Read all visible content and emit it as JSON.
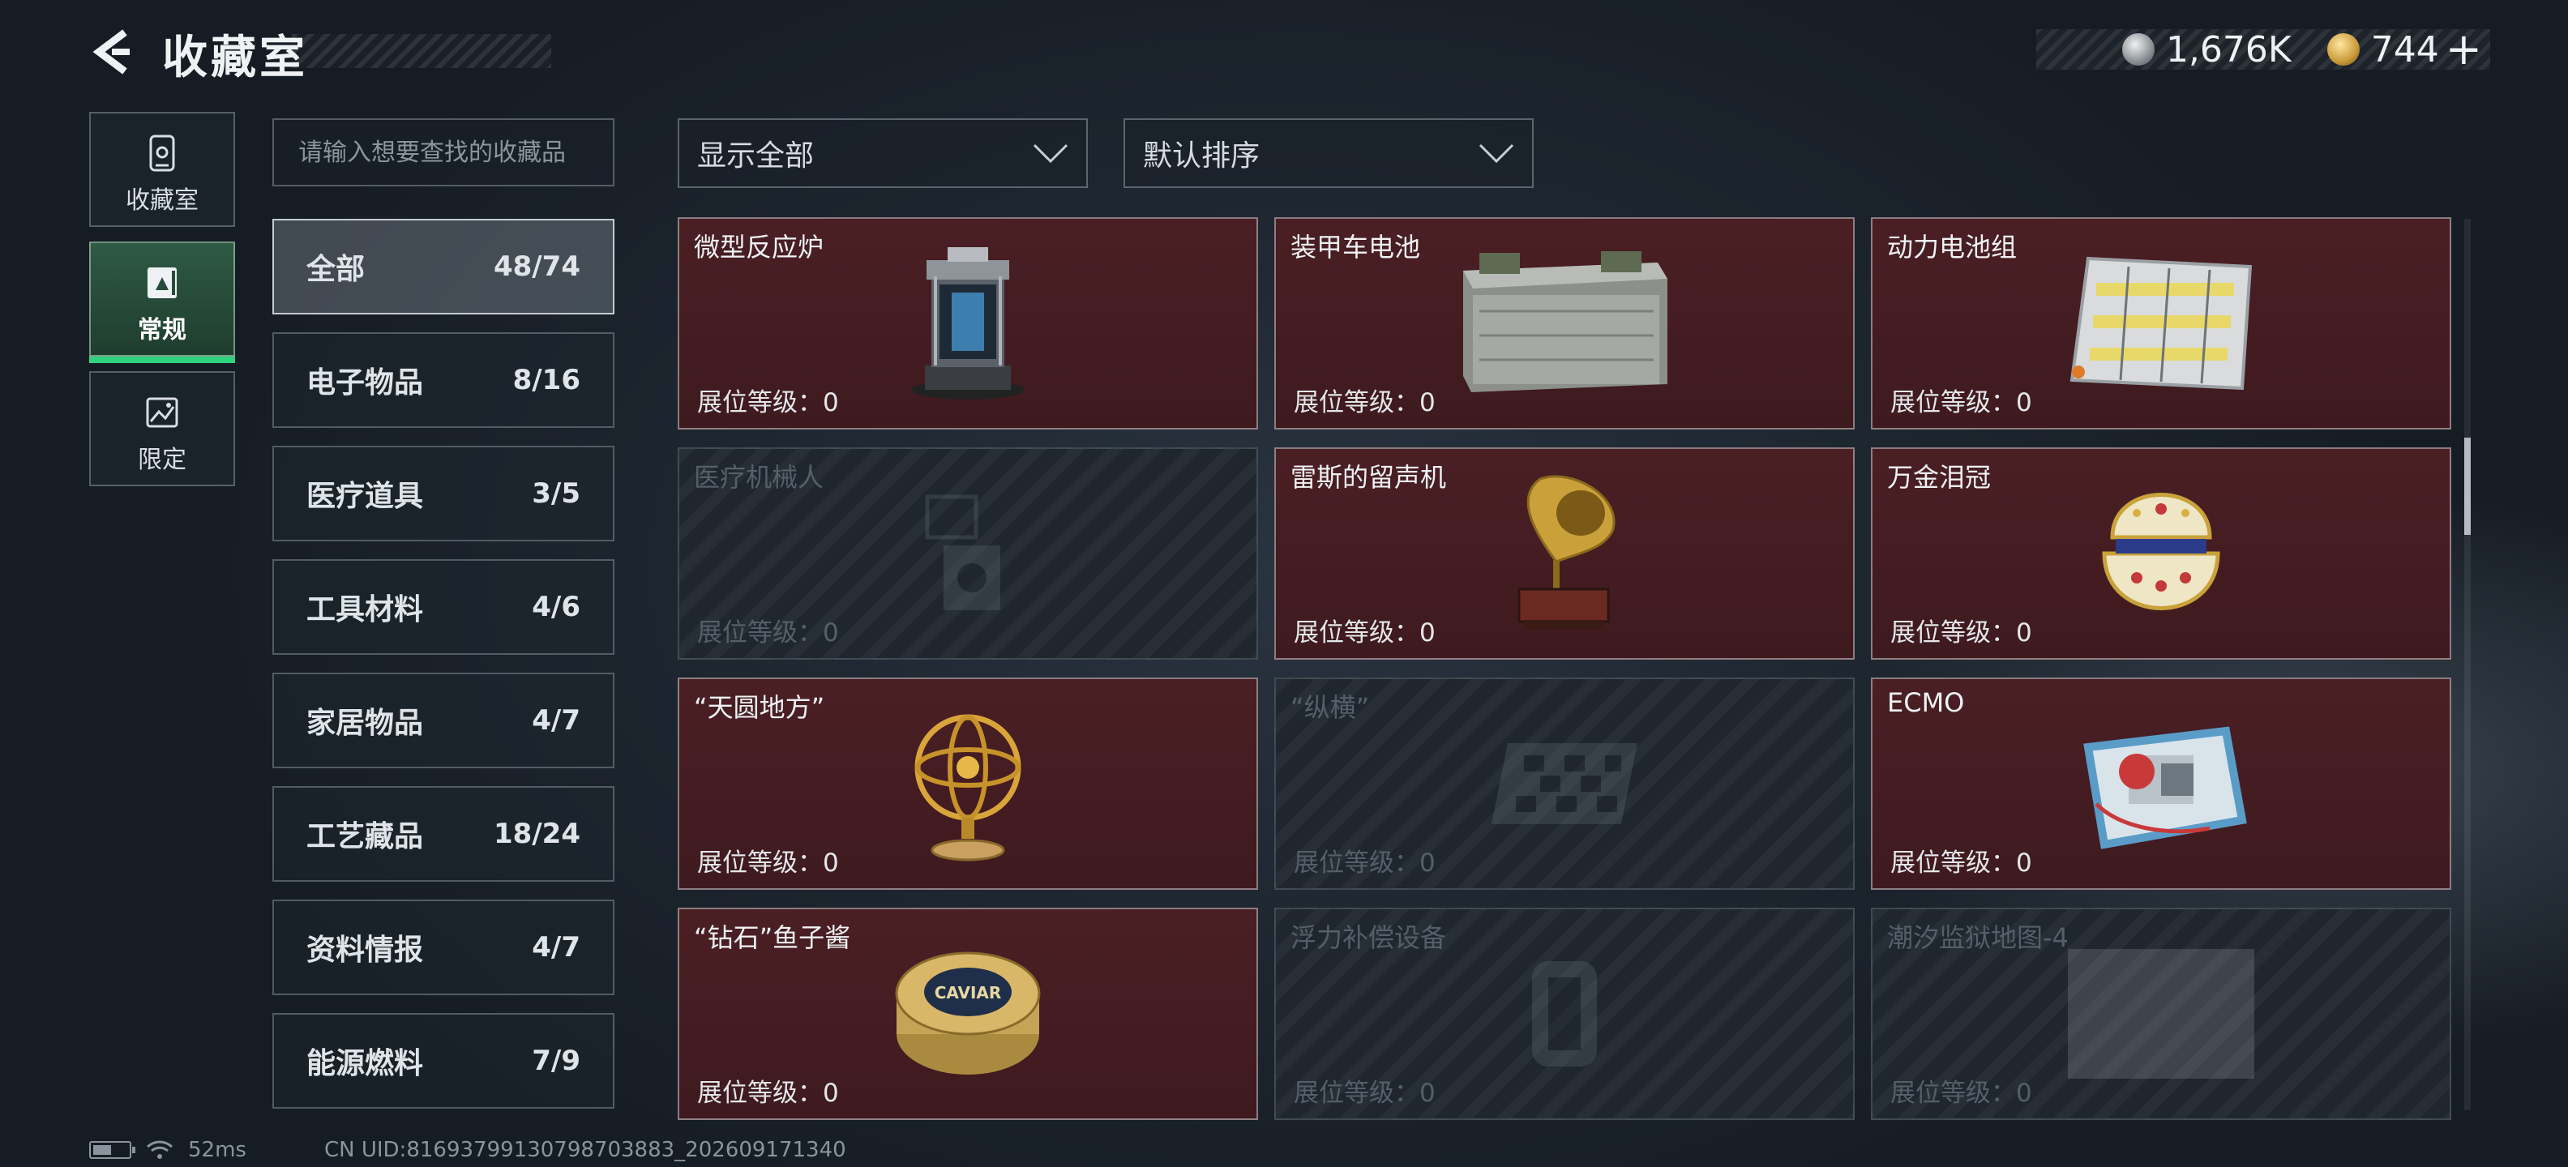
{
  "header": {
    "title": "收藏室",
    "currency": [
      {
        "icon": "silver-coin-icon",
        "value": "1,676K"
      },
      {
        "icon": "gold-coin-icon",
        "value": "744"
      }
    ],
    "add_label": "+"
  },
  "left_nav": [
    {
      "label": "收藏室",
      "icon": "collection-room-icon",
      "active": false
    },
    {
      "label": "常规",
      "icon": "regular-icon",
      "active": true
    },
    {
      "label": "限定",
      "icon": "limited-icon",
      "active": false
    }
  ],
  "search": {
    "placeholder": "请输入想要查找的收藏品",
    "value": ""
  },
  "categories": [
    {
      "name": "全部",
      "count": "48/74",
      "active": true
    },
    {
      "name": "电子物品",
      "count": "8/16"
    },
    {
      "name": "医疗道具",
      "count": "3/5"
    },
    {
      "name": "工具材料",
      "count": "4/6"
    },
    {
      "name": "家居物品",
      "count": "4/7"
    },
    {
      "name": "工艺藏品",
      "count": "18/24"
    },
    {
      "name": "资料情报",
      "count": "4/7"
    },
    {
      "name": "能源燃料",
      "count": "7/9"
    }
  ],
  "filters": {
    "show": "显示全部",
    "sort": "默认排序"
  },
  "items": [
    {
      "name": "微型反应炉",
      "level": "展位等级：0",
      "owned": true,
      "icon": "micro-reactor-icon"
    },
    {
      "name": "装甲车电池",
      "level": "展位等级：0",
      "owned": true,
      "icon": "armored-vehicle-battery-icon"
    },
    {
      "name": "动力电池组",
      "level": "展位等级：0",
      "owned": true,
      "icon": "power-battery-pack-icon"
    },
    {
      "name": "医疗机械人",
      "level": "展位等级：0",
      "owned": false,
      "icon": "medical-robot-icon"
    },
    {
      "name": "雷斯的留声机",
      "level": "展位等级：0",
      "owned": true,
      "icon": "gramophone-icon"
    },
    {
      "name": "万金泪冠",
      "level": "展位等级：0",
      "owned": true,
      "icon": "jeweled-egg-icon"
    },
    {
      "name": "“天圆地方”",
      "level": "展位等级：0",
      "owned": true,
      "icon": "armillary-sphere-icon"
    },
    {
      "name": "“纵横”",
      "level": "展位等级：0",
      "owned": false,
      "icon": "chessboard-icon"
    },
    {
      "name": "ECMO",
      "level": "展位等级：0",
      "owned": true,
      "icon": "ecmo-machine-icon"
    },
    {
      "name": "“钻石”鱼子酱",
      "level": "展位等级：0",
      "owned": true,
      "icon": "caviar-tin-icon"
    },
    {
      "name": "浮力补偿设备",
      "level": "展位等级：0",
      "owned": false,
      "icon": "buoyancy-device-icon"
    },
    {
      "name": "潮汐监狱地图-4",
      "level": "展位等级：0",
      "owned": false,
      "icon": "map-icon"
    }
  ],
  "caviar_label": "CAVIAR",
  "footer": {
    "ping": "52ms",
    "uid": "CN UID:81693799130798703883_202609171340"
  }
}
